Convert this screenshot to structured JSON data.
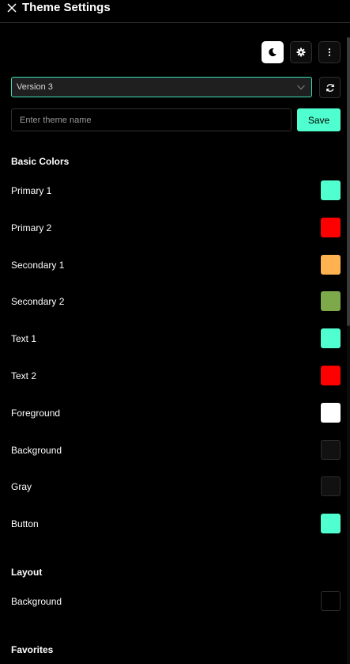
{
  "header": {
    "title": "Theme Settings",
    "close_icon": "close-icon"
  },
  "toolbar": {
    "theme_toggle_icon": "moon-icon",
    "settings_icon": "gear-icon",
    "more_icon": "kebab-menu-icon"
  },
  "version": {
    "selected": "Version 3",
    "refresh_icon": "refresh-icon"
  },
  "theme_name": {
    "value": "",
    "placeholder": "Enter theme name",
    "save_label": "Save"
  },
  "basic_colors": {
    "heading": "Basic Colors",
    "items": [
      {
        "label": "Primary 1",
        "color": "#4fffcf"
      },
      {
        "label": "Primary 2",
        "color": "#ff0000"
      },
      {
        "label": "Secondary 1",
        "color": "#ffb24f"
      },
      {
        "label": "Secondary 2",
        "color": "#7ea94a"
      },
      {
        "label": "Text 1",
        "color": "#4fffcf"
      },
      {
        "label": "Text 2",
        "color": "#ff0000"
      },
      {
        "label": "Foreground",
        "color": "#ffffff"
      },
      {
        "label": "Background",
        "color": "#111111"
      },
      {
        "label": "Gray",
        "color": "#111111"
      },
      {
        "label": "Button",
        "color": "#4fffcf"
      }
    ]
  },
  "layout": {
    "heading": "Layout",
    "items": [
      {
        "label": "Background",
        "color": "#000000"
      }
    ]
  },
  "favorites": {
    "heading": "Favorites"
  }
}
